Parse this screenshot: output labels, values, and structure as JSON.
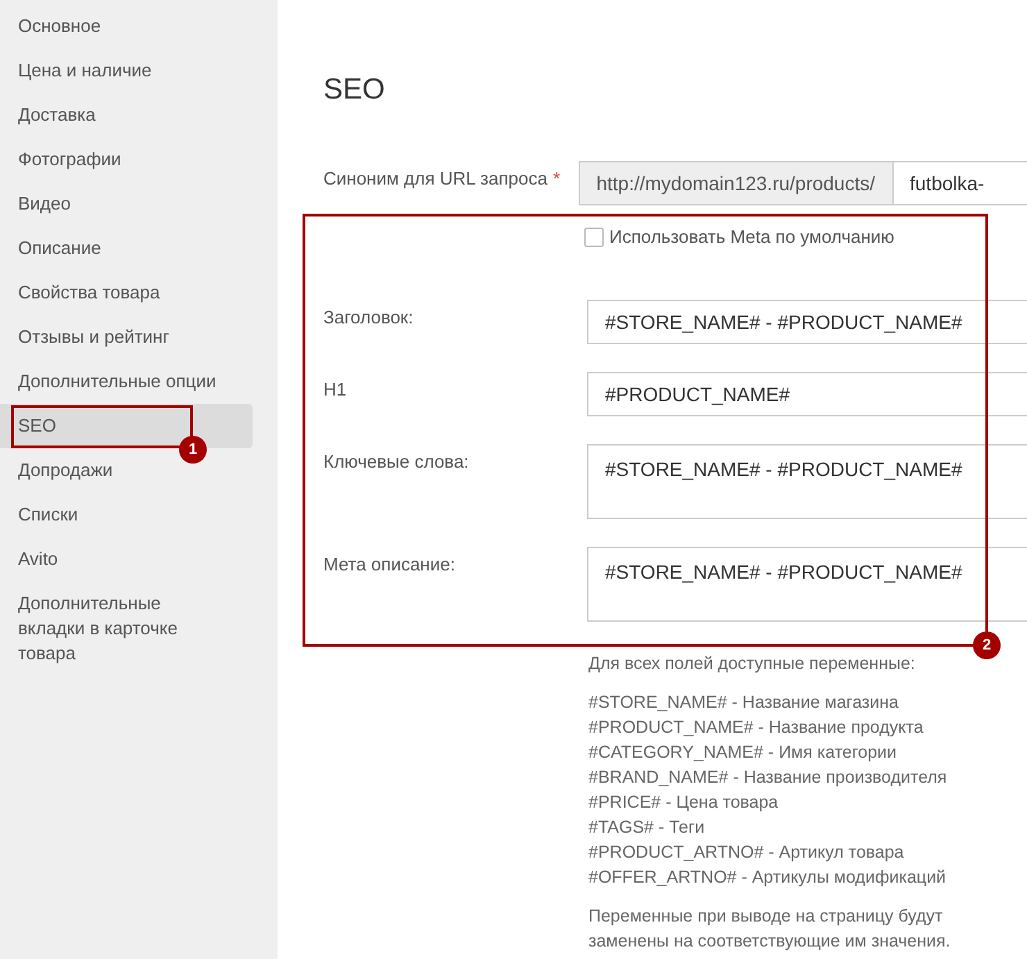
{
  "sidebar": {
    "items": [
      {
        "label": "Основное",
        "selected": false
      },
      {
        "label": "Цена и наличие",
        "selected": false
      },
      {
        "label": "Доставка",
        "selected": false
      },
      {
        "label": "Фотографии",
        "selected": false
      },
      {
        "label": "Видео",
        "selected": false
      },
      {
        "label": "Описание",
        "selected": false
      },
      {
        "label": "Свойства товара",
        "selected": false
      },
      {
        "label": "Отзывы и рейтинг",
        "selected": false
      },
      {
        "label": "Дополнительные опции",
        "selected": false
      },
      {
        "label": "SEO",
        "selected": true
      },
      {
        "label": "Допродажи",
        "selected": false
      },
      {
        "label": "Списки",
        "selected": false
      },
      {
        "label": "Avito",
        "selected": false
      },
      {
        "label": "Дополнительные вкладки в карточке товара",
        "selected": false
      }
    ]
  },
  "section_title": "SEO",
  "url_row": {
    "label": "Синоним для URL запроса",
    "required_mark": "*",
    "prefix": "http://mydomain123.ru/products/",
    "value": "futbolka-"
  },
  "use_default_meta": {
    "label": "Использовать Meta по умолчанию",
    "checked": false
  },
  "fields": [
    {
      "label": "Заголовок:",
      "value": "#STORE_NAME# - #PRODUCT_NAME#",
      "kind": "input"
    },
    {
      "label": "H1",
      "value": "#PRODUCT_NAME#",
      "kind": "input"
    },
    {
      "label": "Ключевые слова:",
      "value": "#STORE_NAME# - #PRODUCT_NAME#",
      "kind": "textarea"
    },
    {
      "label": "Мета описание:",
      "value": "#STORE_NAME# - #PRODUCT_NAME#",
      "kind": "textarea"
    }
  ],
  "help": {
    "intro": "Для всех полей доступные переменные:",
    "variables": [
      "#STORE_NAME# - Название магазина",
      "#PRODUCT_NAME# - Название продукта",
      "#CATEGORY_NAME# - Имя категории",
      "#BRAND_NAME# - Название производителя",
      "#PRICE# - Цена товара",
      "#TAGS# - Теги",
      "#PRODUCT_ARTNO# - Артикул товара",
      "#OFFER_ARTNO# - Артикулы модификаций"
    ],
    "note": "Переменные при выводе на страницу будут заменены на соответствующие им значения."
  },
  "annotations": [
    {
      "label": "1"
    },
    {
      "label": "2"
    }
  ]
}
